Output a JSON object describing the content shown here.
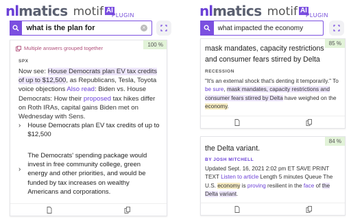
{
  "brand": {
    "nl": "nl",
    "matics": "matics",
    "motif": "motif",
    "ai": "AI",
    "plugin": "PLUGIN"
  },
  "left": {
    "search": {
      "value": "what is the plan for"
    },
    "result": {
      "grouped_label": "Multiple answers grouped together",
      "score": "100 %",
      "source": "SPX",
      "body": {
        "p1": "Now see: ",
        "h1": "House Democrats plan EV tax credits of up to $12,500",
        "p2": ", as Republicans, Tesla, Toyota voice objections ",
        "l1": "Also read",
        "p3": ": Biden vs. House Democrats: How their ",
        "l2": "proposed",
        "p4": " tax hikes differ on Roth IRAs, capital gains Biden met on Wednesday with Sens."
      },
      "answers": [
        {
          "text": "House Democrats plan EV tax credits of up to $12,500"
        },
        {
          "text": "The Democrats' spending package would invest in free community college, green energy and other priorities, and would be funded by tax increases on wealthy Americans and corporations."
        }
      ]
    }
  },
  "right": {
    "search": {
      "value": "what impacted the economy"
    },
    "card1": {
      "score": "85 %",
      "title": "mask mandates, capacity restrictions and consumer fears stirred by Delta",
      "source": "RECESSION",
      "q1": "\"It's an external shock that's denting it temporarily.\" To ",
      "l1": "be sure",
      "q2": ", ",
      "h1": "mask mandates, capacity restrictions and consumer fears stirred by Delta",
      "q3": " have weighed on the ",
      "h2": "economy",
      "q4": "."
    },
    "card2": {
      "score": "84 %",
      "title": "the Delta variant.",
      "source": "BY JOSH MITCHELL",
      "t1": "Updated Sept. 16, 2021 2:02 pm ET SAVE PRINT TEXT ",
      "l1": "Listen to article",
      "t2": " Length 5 minutes Queue The U.S. ",
      "h1": "economy",
      "t3": " is ",
      "l2": "proving",
      "t4": " resilient in the ",
      "l3": "face",
      "t5": " of ",
      "h2": "the Delta",
      "t6": " ",
      "h3": "variant",
      "t7": "."
    }
  },
  "icons": {
    "search": "search-icon",
    "clear": "clear-icon",
    "expand": "expand-icon",
    "doc": "document-icon",
    "copy": "copy-icon",
    "chevron": "chevron-right-icon",
    "grouped": "grouped-icon"
  },
  "colors": {
    "accent": "#7b4fe0",
    "score_bg": "#e2f3d8",
    "highlight": "#ede6fb",
    "highlight_yellow": "#f8edc3",
    "link": "#6a3fd6",
    "grouped_text": "#b0507a"
  }
}
